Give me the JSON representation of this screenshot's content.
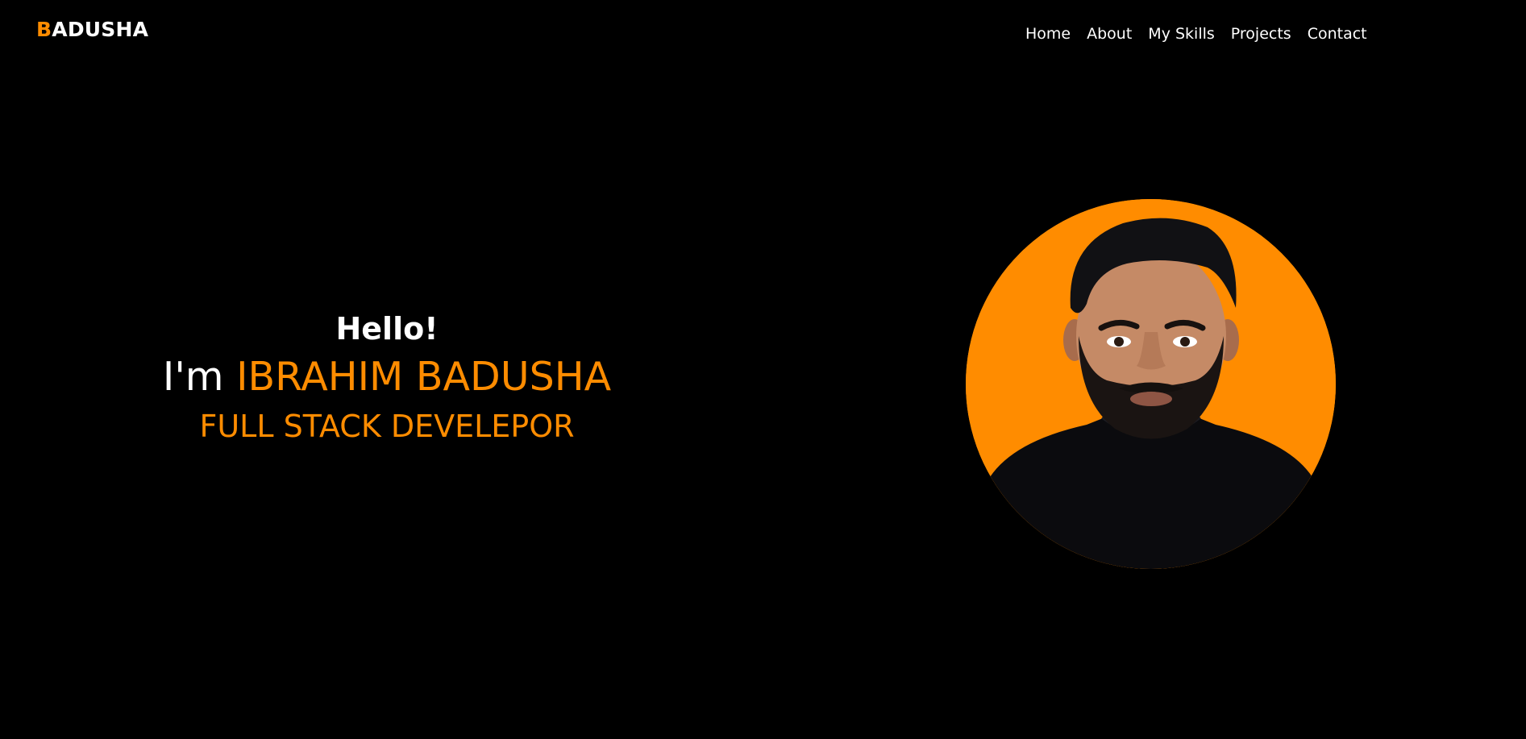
{
  "header": {
    "logo_accent": "B",
    "logo_rest": "ADUSHA"
  },
  "nav": {
    "items": [
      {
        "label": "Home"
      },
      {
        "label": "About"
      },
      {
        "label": "My Skills"
      },
      {
        "label": "Projects"
      },
      {
        "label": "Contact"
      }
    ]
  },
  "hero": {
    "greeting": "Hello!",
    "intro_prefix": "I'm",
    "name": "IBRAHIM BADUSHA",
    "role": "FULL STACK DEVELEPOR"
  },
  "colors": {
    "background": "#000000",
    "accent": "#ff8c00",
    "text": "#ffffff"
  },
  "avatar": {
    "icon": "profile-photo"
  }
}
